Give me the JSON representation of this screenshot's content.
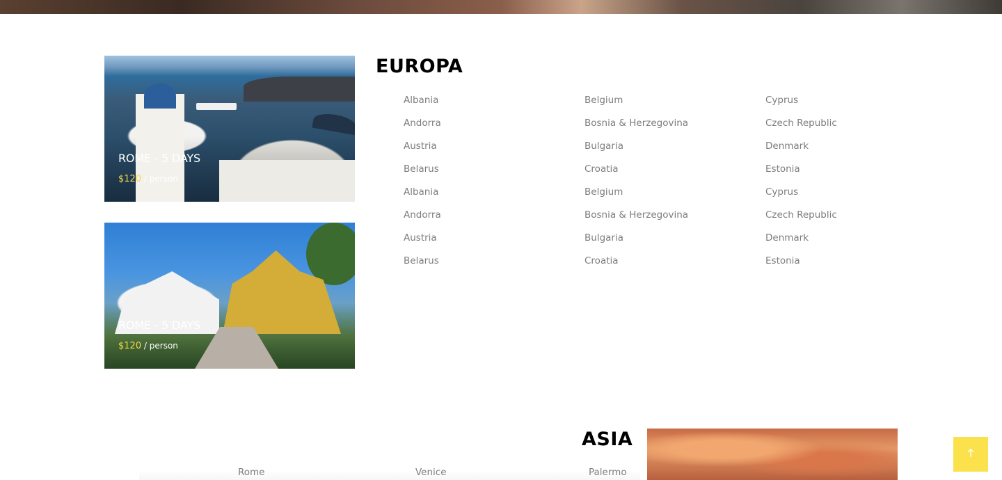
{
  "tour_cards": [
    {
      "title": "ROME - 5 DAYS",
      "price": "$120",
      "per": "/ person"
    },
    {
      "title": "ROME - 5 DAYS",
      "price": "$120",
      "per": "/ person"
    }
  ],
  "europa": {
    "title": "EUROPA",
    "columns": [
      [
        "Albania",
        "Andorra",
        "Austria",
        "Belarus",
        "Albania",
        "Andorra",
        "Austria",
        "Belarus"
      ],
      [
        "Belgium",
        "Bosnia & Herzegovina",
        "Bulgaria",
        "Croatia",
        "Belgium",
        "Bosnia & Herzegovina",
        "Bulgaria",
        "Croatia"
      ],
      [
        "Cyprus",
        "Czech Republic",
        "Denmark",
        "Estonia",
        "Cyprus",
        "Czech Republic",
        "Denmark",
        "Estonia"
      ]
    ]
  },
  "asia": {
    "title": "ASIA",
    "items": [
      "Rome",
      "Venice",
      "Palermo"
    ]
  },
  "back_to_top": {
    "icon": "arrow-up-icon"
  },
  "colors": {
    "accent": "#fbe14b",
    "price": "#f6d84a",
    "list_text": "#7d7d7d"
  }
}
